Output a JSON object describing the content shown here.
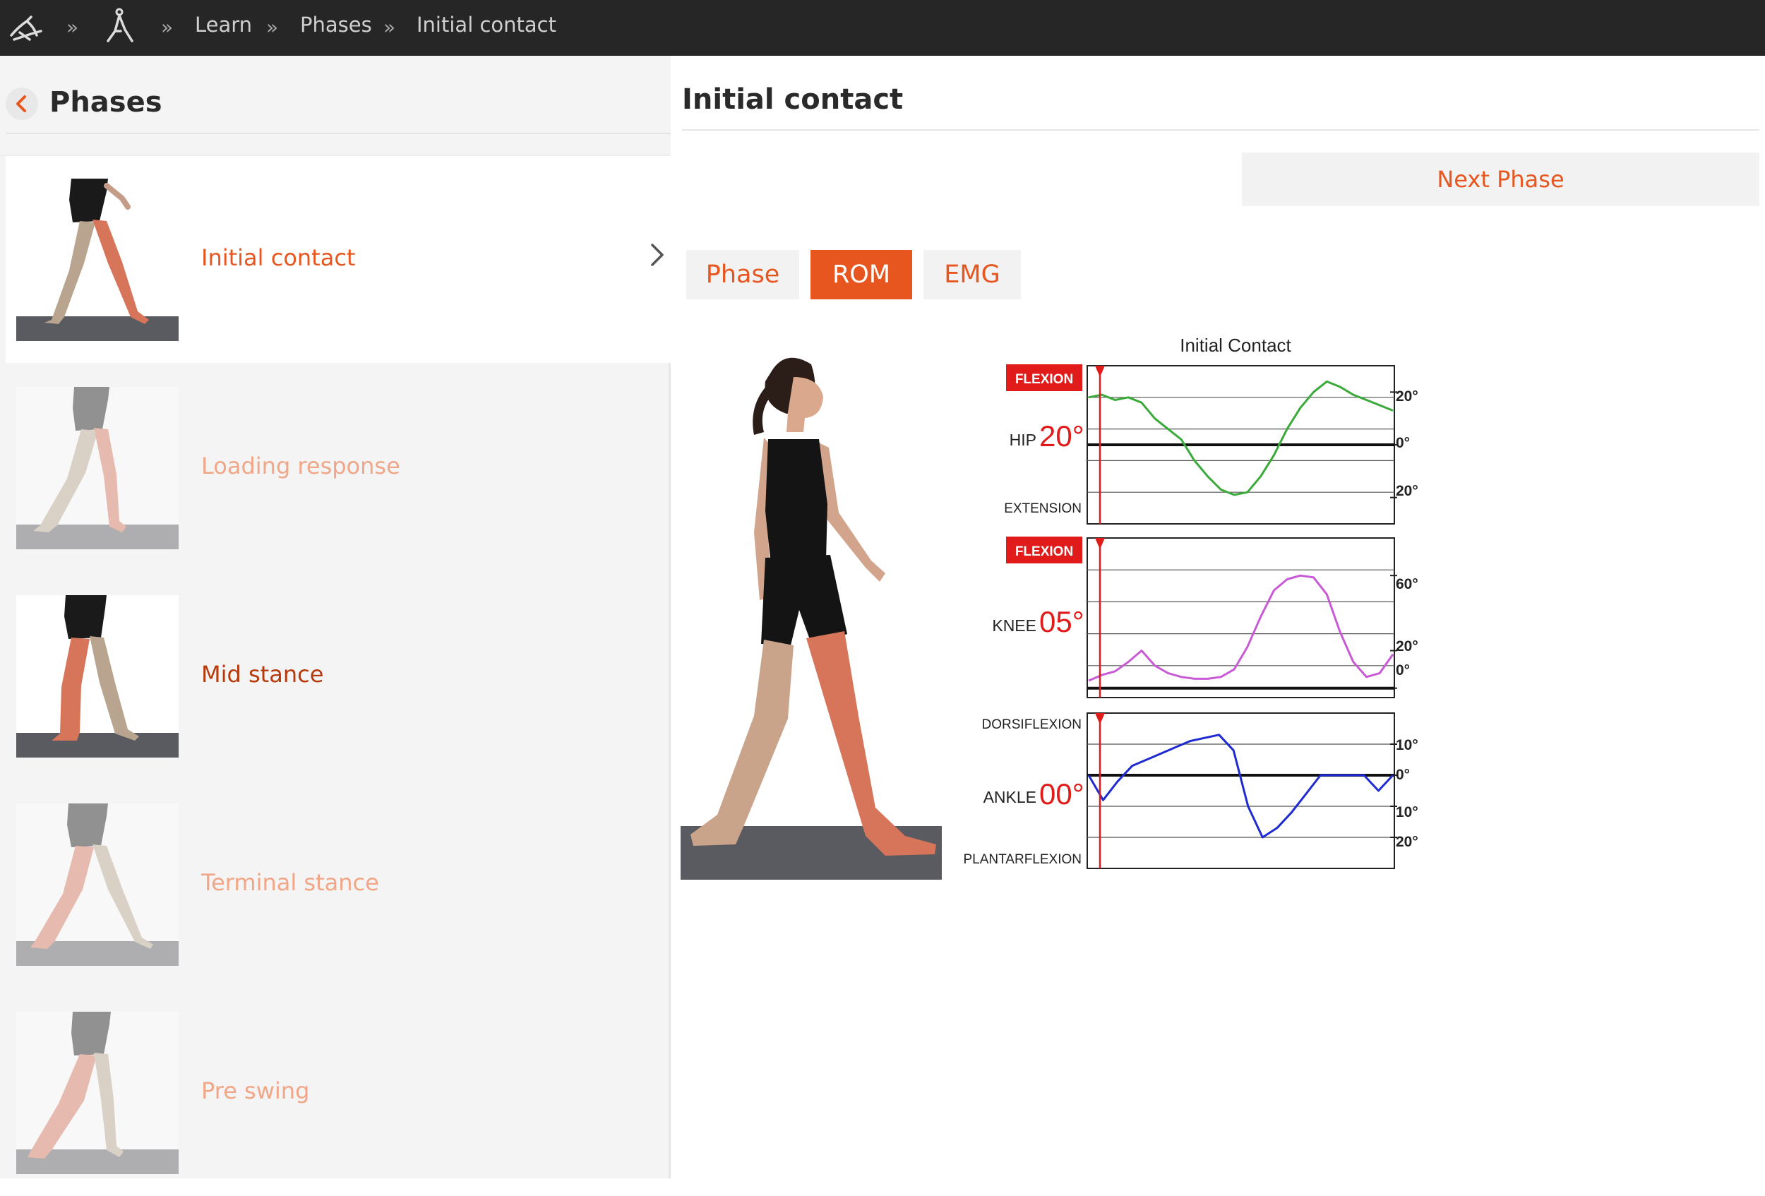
{
  "breadcrumb": {
    "separator": "»",
    "items": [
      "Learn",
      "Phases",
      "Initial contact"
    ]
  },
  "sidebar": {
    "title": "Phases",
    "items": [
      {
        "label": "Initial contact",
        "state": "active"
      },
      {
        "label": "Loading response",
        "state": "faded"
      },
      {
        "label": "Mid stance",
        "state": "normal"
      },
      {
        "label": "Terminal stance",
        "state": "faded"
      },
      {
        "label": "Pre swing",
        "state": "faded"
      }
    ]
  },
  "main": {
    "title": "Initial contact",
    "next_label": "Next Phase",
    "tabs": [
      {
        "label": "Phase",
        "active": false
      },
      {
        "label": "ROM",
        "active": true
      },
      {
        "label": "EMG",
        "active": false
      }
    ]
  },
  "colors": {
    "accent": "#e8561f",
    "topbar": "#262626",
    "hip_line": "#3aaa3a",
    "knee_line": "#c95ad6",
    "ankle_line": "#1e2bd0",
    "flag_red": "#e11a1a"
  },
  "chart_data": {
    "type": "line",
    "title": "Initial Contact",
    "panels": [
      {
        "joint": "HIP",
        "angle": "20°",
        "top_label": "FLEXION",
        "bottom_label": "EXTENSION",
        "tick_labels": [
          "20°",
          "0°",
          "20°"
        ],
        "ylim": [
          -30,
          30
        ],
        "tick_values": [
          20,
          0,
          -20
        ],
        "series": [
          {
            "values": [
              18,
              19,
              17,
              18,
              16,
              10,
              6,
              2,
              -6,
              -12,
              -17,
              -19,
              -18,
              -12,
              -4,
              6,
              14,
              20,
              24,
              22,
              19,
              17,
              15,
              13
            ]
          }
        ]
      },
      {
        "joint": "KNEE",
        "angle": "05°",
        "top_label": "FLEXION",
        "bottom_label": "",
        "tick_labels": [
          "60°",
          "20°",
          "0°"
        ],
        "ylim": [
          -5,
          80
        ],
        "tick_values": [
          60,
          20,
          0
        ],
        "series": [
          {
            "values": [
              4,
              7,
              9,
              14,
              20,
              12,
              8,
              6,
              5,
              5,
              6,
              10,
              22,
              38,
              52,
              58,
              60,
              59,
              50,
              30,
              14,
              6,
              8,
              18
            ]
          }
        ]
      },
      {
        "joint": "ANKLE",
        "angle": "00°",
        "top_label": "DORSIFLEXION",
        "bottom_label": "PLANTARFLEXION",
        "tick_labels": [
          "10°",
          "0°",
          "10°",
          "20°"
        ],
        "ylim": [
          -30,
          20
        ],
        "tick_values": [
          10,
          0,
          -10,
          -20
        ],
        "series": [
          {
            "values": [
              0,
              -8,
              -2,
              3,
              5,
              7,
              9,
              11,
              12,
              13,
              8,
              -10,
              -20,
              -17,
              -12,
              -6,
              0,
              0,
              0,
              0,
              -5,
              0
            ]
          }
        ]
      }
    ]
  }
}
